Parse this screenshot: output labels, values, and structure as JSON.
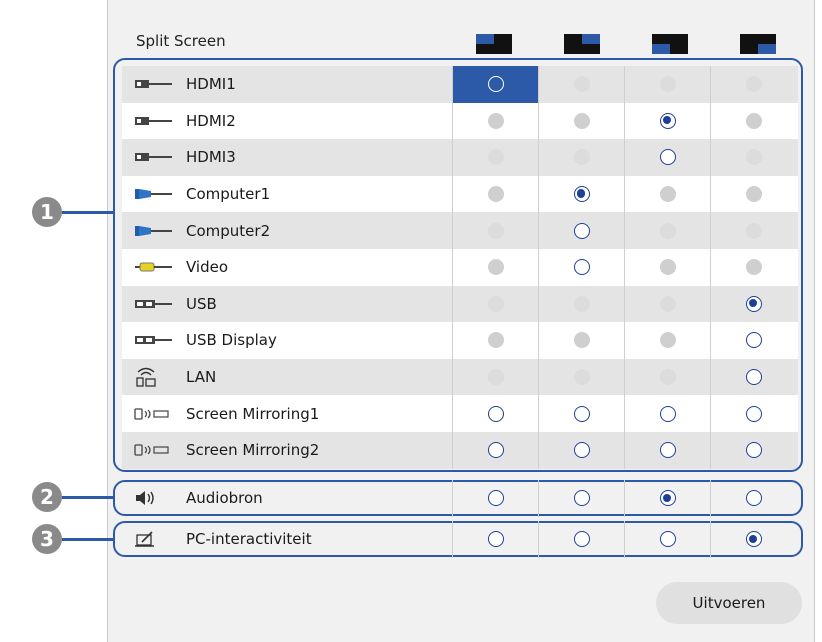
{
  "header": {
    "title": "Split Screen",
    "layouts": [
      {
        "name": "layout-top-left-icon",
        "corner": "top-left"
      },
      {
        "name": "layout-top-right-icon",
        "corner": "top-right"
      },
      {
        "name": "layout-bottom-left-icon",
        "corner": "bottom-left"
      },
      {
        "name": "layout-bottom-right-icon",
        "corner": "bottom-right"
      }
    ]
  },
  "sources": [
    {
      "label": "HDMI1",
      "icon": "hdmi-plug-icon",
      "states": [
        "selected-cell",
        "disabled-light",
        "disabled-light",
        "disabled-light"
      ]
    },
    {
      "label": "HDMI2",
      "icon": "hdmi-plug-icon",
      "states": [
        "disabled",
        "disabled",
        "selected",
        "disabled"
      ]
    },
    {
      "label": "HDMI3",
      "icon": "hdmi-plug-icon",
      "states": [
        "disabled-light",
        "disabled-light",
        "empty",
        "disabled-light"
      ]
    },
    {
      "label": "Computer1",
      "icon": "vga-plug-icon",
      "states": [
        "disabled",
        "selected",
        "disabled",
        "disabled"
      ]
    },
    {
      "label": "Computer2",
      "icon": "vga-plug-icon",
      "states": [
        "disabled-light",
        "empty",
        "disabled-light",
        "disabled-light"
      ]
    },
    {
      "label": "Video",
      "icon": "rca-plug-icon",
      "states": [
        "disabled",
        "empty",
        "disabled",
        "disabled"
      ]
    },
    {
      "label": "USB",
      "icon": "usb-plug-icon",
      "states": [
        "disabled-light",
        "disabled-light",
        "disabled-light",
        "selected"
      ]
    },
    {
      "label": "USB Display",
      "icon": "usb-display-plug-icon",
      "states": [
        "disabled",
        "disabled",
        "disabled",
        "empty"
      ]
    },
    {
      "label": "LAN",
      "icon": "lan-wireless-icon",
      "states": [
        "disabled-light",
        "disabled-light",
        "disabled-light",
        "empty"
      ]
    },
    {
      "label": "Screen Mirroring1",
      "icon": "screen-mirroring-icon",
      "states": [
        "empty",
        "empty",
        "empty",
        "empty"
      ]
    },
    {
      "label": "Screen Mirroring2",
      "icon": "screen-mirroring-icon",
      "states": [
        "empty",
        "empty",
        "empty",
        "empty"
      ]
    }
  ],
  "audio": {
    "label": "Audiobron",
    "icon": "speaker-icon",
    "states": [
      "empty",
      "empty",
      "selected",
      "empty"
    ]
  },
  "interactivity": {
    "label": "PC-interactiviteit",
    "icon": "pen-tablet-icon",
    "states": [
      "empty",
      "empty",
      "empty",
      "selected"
    ]
  },
  "callouts": [
    "1",
    "2",
    "3"
  ],
  "execute_label": "Uitvoeren",
  "colors": {
    "accent": "#2d5aa8",
    "radio": "#1d3f99",
    "callout": "#8a8a8a"
  }
}
